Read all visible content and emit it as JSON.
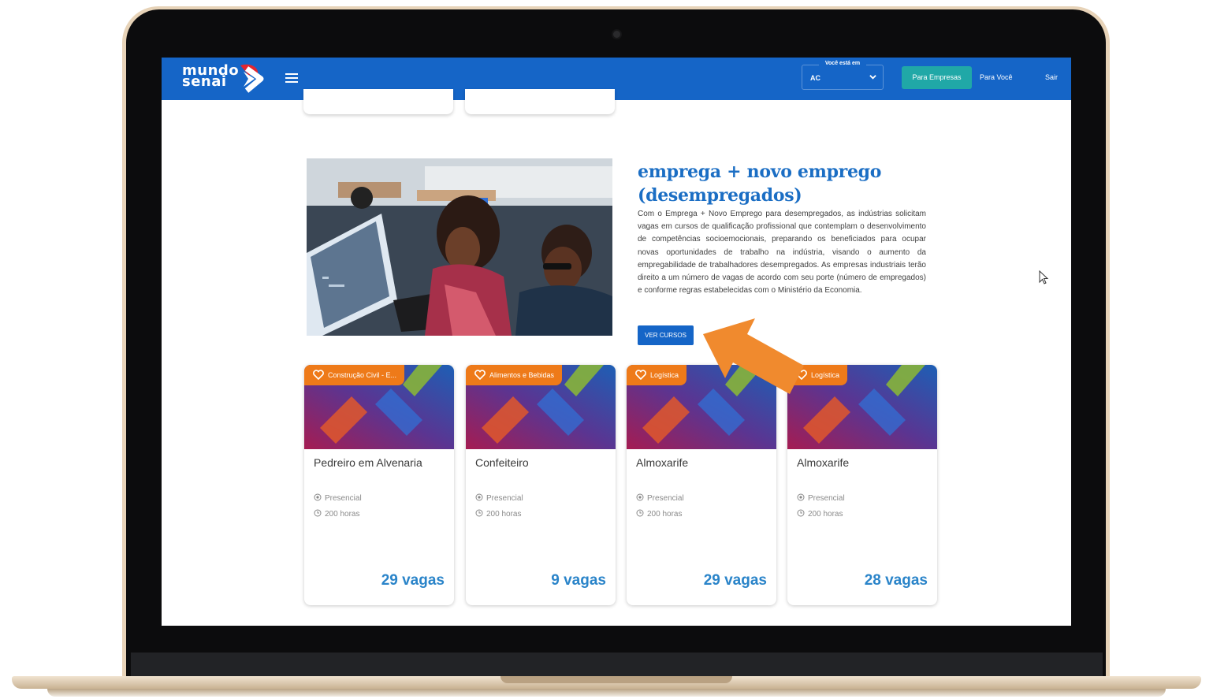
{
  "header": {
    "logo_line1": "mundo",
    "logo_line2": "senai",
    "state_label": "Você está em",
    "state_value": "AC",
    "btn_empresas": "Para Empresas",
    "btn_voce": "Para Você",
    "btn_sair": "Sair"
  },
  "feature": {
    "title_line1": "emprega + novo emprego",
    "title_line2": "(desempregados)",
    "description": "Com o Emprega + Novo Emprego para desempregados, as indústrias solicitam vagas em cursos de qualificação profissional que contemplam o desenvolvimento de competências socioemocionais, preparando os beneficiados para ocupar novas oportunidades de trabalho na indústria, visando o aumento da empregabilidade de trabalhadores desempregados. As empresas industriais terão direito a um número de vagas de acordo com seu porte (número de empregados) e conforme regras estabelecidas com o Ministério da Economia.",
    "button": "VER CURSOS"
  },
  "courses": [
    {
      "tag": "Construção Civil - E...",
      "title": "Pedreiro em Alvenaria",
      "mode": "Presencial",
      "hours": "200 horas",
      "vagas": "29 vagas"
    },
    {
      "tag": "Alimentos e Bebidas",
      "title": "Confeiteiro",
      "mode": "Presencial",
      "hours": "200 horas",
      "vagas": "9 vagas"
    },
    {
      "tag": "Logística",
      "title": "Almoxarife",
      "mode": "Presencial",
      "hours": "200 horas",
      "vagas": "29 vagas"
    },
    {
      "tag": "Logística",
      "title": "Almoxarife",
      "mode": "Presencial",
      "hours": "200 horas",
      "vagas": "28 vagas"
    }
  ],
  "colors": {
    "primary": "#1565c7",
    "teal": "#20a8a7",
    "tag_orange": "#ee7a19",
    "arrow_orange": "#f08a2e",
    "vagas_blue": "#2a84c9"
  },
  "icons": [
    "menu-icon",
    "heart-icon",
    "location-icon",
    "clock-icon",
    "chevron-down-icon",
    "mouse-cursor-icon",
    "annotation-arrow"
  ]
}
